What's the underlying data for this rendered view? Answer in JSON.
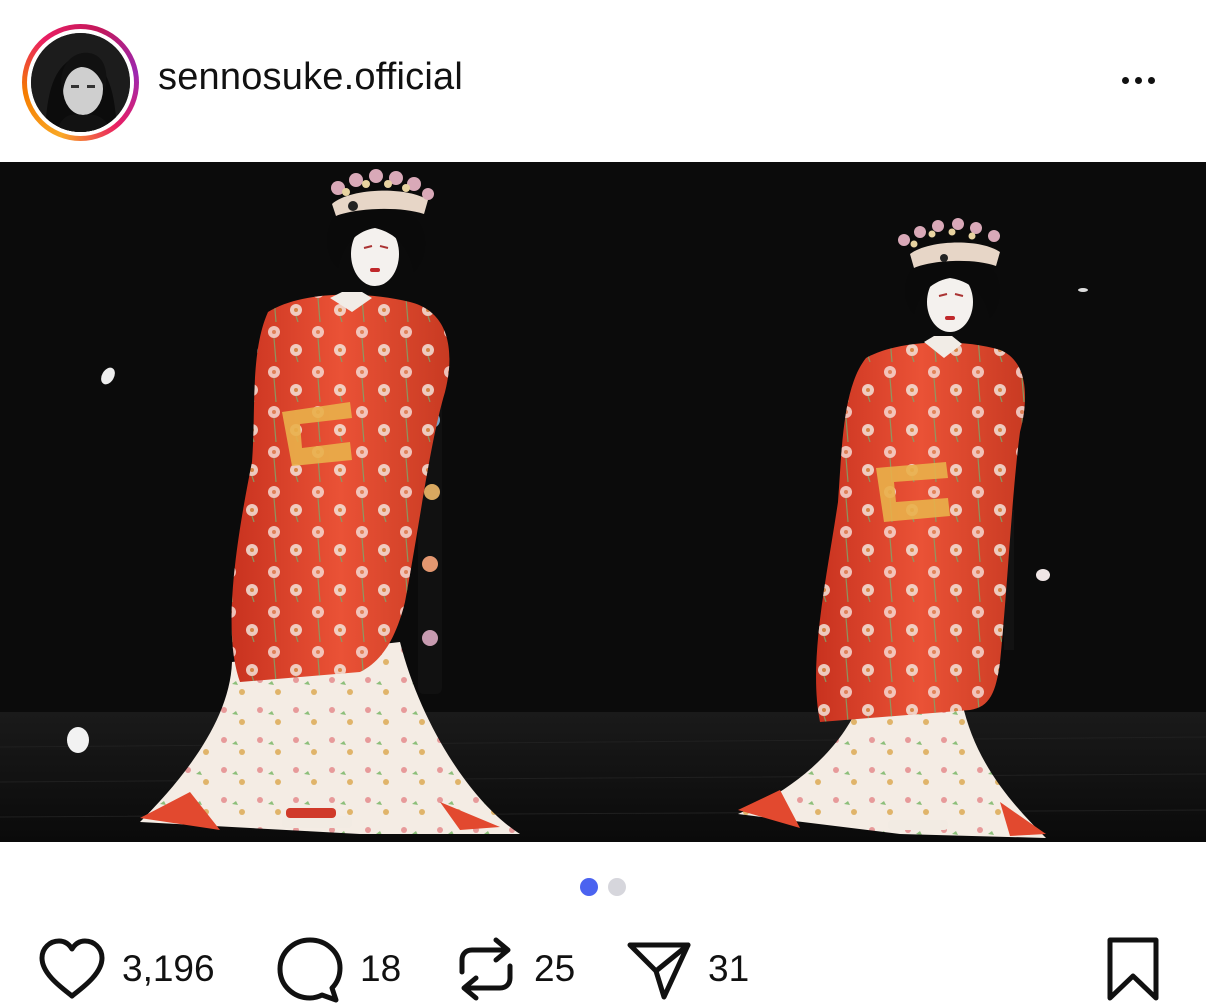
{
  "post": {
    "username": "sennosuke.official",
    "avatar_icon": "profile-photo",
    "more_icon": "more-horizontal-icon"
  },
  "media": {
    "description_icon": "kabuki-performers-photo",
    "slides_total": 2,
    "slide_current": 1
  },
  "actions": {
    "likes": "3,196",
    "comments": "18",
    "reposts": "25",
    "shares": "31"
  },
  "colors": {
    "accent": "#4b63f0",
    "kimono_red": "#e2492f",
    "story_ring": "#e91e63"
  }
}
